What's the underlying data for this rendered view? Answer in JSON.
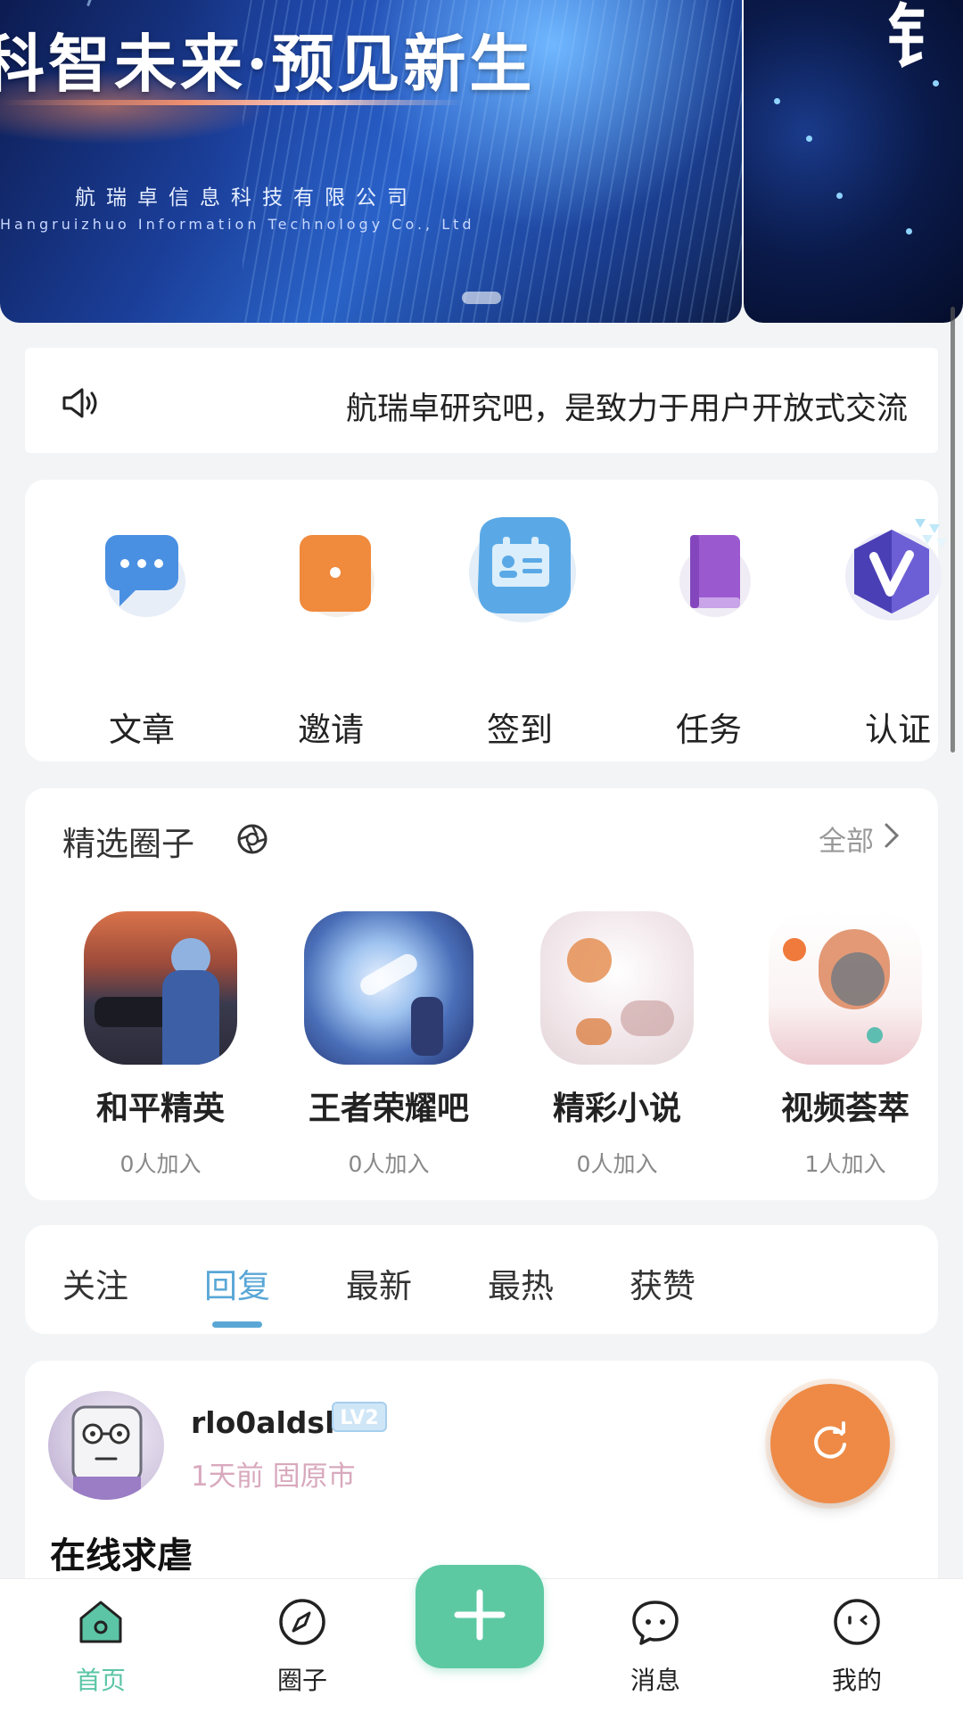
{
  "banner": {
    "title": "科智未来·预见新生",
    "company_cn": "航瑞卓信息科技有限公司",
    "company_en": "Hangruizhuo Information Technology Co., Ltd",
    "side_glyph": "钅"
  },
  "notice": {
    "text": "航瑞卓研究吧，是致力于用户开放式交流"
  },
  "quick_actions": [
    {
      "label": "文章",
      "icon": "chat-bubble-icon",
      "color": "#4a90e2"
    },
    {
      "label": "邀请",
      "icon": "invite-box-icon",
      "color": "#f08a3c"
    },
    {
      "label": "签到",
      "icon": "checkin-card-icon",
      "color": "#5aa9e6"
    },
    {
      "label": "任务",
      "icon": "book-icon",
      "color": "#9b59d0"
    },
    {
      "label": "认证",
      "icon": "verified-v-icon",
      "color": "#4b3fb5"
    }
  ],
  "circles": {
    "title": "精选圈子",
    "all_label": "全部",
    "items": [
      {
        "name": "和平精英",
        "count": "0人加入"
      },
      {
        "name": "王者荣耀吧",
        "count": "0人加入"
      },
      {
        "name": "精彩小说",
        "count": "0人加入"
      },
      {
        "name": "视频荟萃",
        "count": "1人加入"
      }
    ]
  },
  "tabs": {
    "items": [
      "关注",
      "回复",
      "最新",
      "最热",
      "获赞"
    ],
    "active_index": 1
  },
  "post": {
    "username": "rlo0aldsl",
    "level": "LV2",
    "meta": "1天前 固原市",
    "title": "在线求虐"
  },
  "bottom_nav": {
    "items": [
      {
        "label": "首页",
        "icon": "home-icon",
        "active": true
      },
      {
        "label": "圈子",
        "icon": "compass-icon",
        "active": false
      },
      {
        "label": "消息",
        "icon": "message-icon",
        "active": false
      },
      {
        "label": "我的",
        "icon": "profile-face-icon",
        "active": false
      }
    ],
    "add_icon": "plus-icon"
  },
  "colors": {
    "accent_blue": "#5aa7d6",
    "accent_green": "#5cc9a3",
    "refresh_orange": "#ee8a46"
  }
}
